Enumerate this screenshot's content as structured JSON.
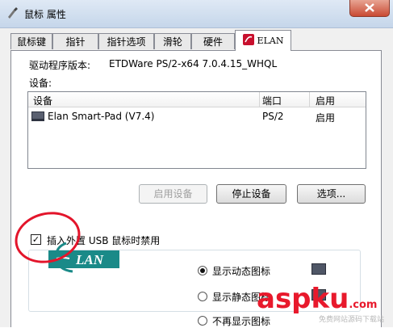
{
  "window": {
    "title": "鼠标 属性"
  },
  "tabs": [
    {
      "label": "鼠标键"
    },
    {
      "label": "指针"
    },
    {
      "label": "指针选项"
    },
    {
      "label": "滑轮"
    },
    {
      "label": "硬件"
    },
    {
      "label": "ELAN",
      "active": true
    }
  ],
  "driver": {
    "label": "驱动程序版本:",
    "value": "ETDWare PS/2-x64 7.0.4.15_WHQL"
  },
  "devices": {
    "section_label": "设备:",
    "columns": [
      "设备",
      "端口",
      "启用"
    ],
    "rows": [
      {
        "name": "Elan Smart-Pad  (V7.4)",
        "port": "PS/2",
        "enabled": "启用"
      }
    ]
  },
  "buttons": {
    "enable": "启用设备",
    "stop": "停止设备",
    "options": "选项..."
  },
  "disable_on_usb": {
    "checked": true,
    "label": "插入外置 USB 鼠标时禁用"
  },
  "tray_icon": {
    "options": [
      {
        "label": "显示动态图标",
        "selected": true
      },
      {
        "label": "显示静态图标",
        "selected": false
      },
      {
        "label": "不再显示图标",
        "selected": false
      }
    ]
  },
  "logo": {
    "text": "LAN"
  },
  "watermark": {
    "text": "aspku",
    "suffix": ".com",
    "sub": "免费网站源码下载站"
  },
  "colors": {
    "annotation_red": "#e3152b",
    "logo_teal": "#1a8a88",
    "watermark_red": "#e8192c",
    "watermark_blue": "#1c4b9c"
  }
}
